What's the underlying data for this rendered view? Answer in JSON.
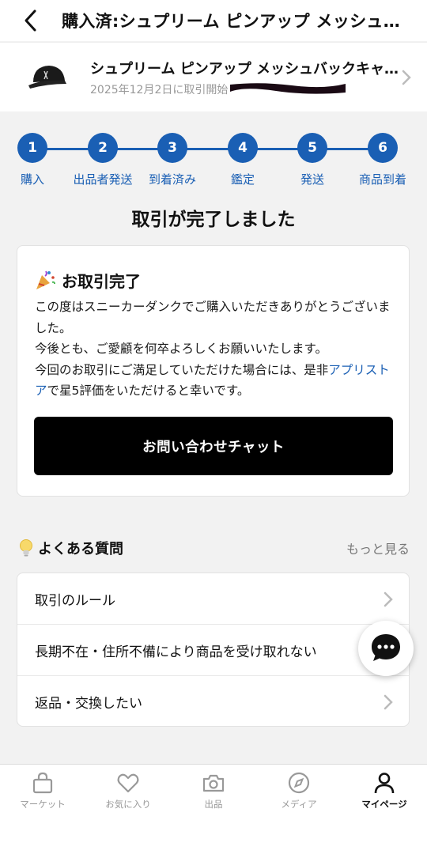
{
  "header": {
    "title": "購入済:シュプリーム ピンアップ メッシュバックキャップ"
  },
  "product": {
    "name": "シュプリーム ピンアップ メッシュバックキャップ",
    "subtitle": "2025年12月2日に取引開始"
  },
  "steps": [
    {
      "number": "1",
      "label": "購入"
    },
    {
      "number": "2",
      "label": "出品者発送"
    },
    {
      "number": "3",
      "label": "到着済み"
    },
    {
      "number": "4",
      "label": "鑑定"
    },
    {
      "number": "5",
      "label": "発送"
    },
    {
      "number": "6",
      "label": "商品到着"
    }
  ],
  "done_title": "取引が完了しました",
  "card": {
    "title": "お取引完了",
    "line1": "この度はスニーカーダンクでご購入いただきありがとうございました。",
    "line2": "今後とも、ご愛顧を何卒よろしくお願いいたします。",
    "line3_pre": "今回のお取引にご満足していただけた場合には、是非",
    "line3_link": "アプリストア",
    "line3_post": "で星5評価をいただけると幸いです。",
    "button": "お問い合わせチャット"
  },
  "faq": {
    "title": "よくある質問",
    "more": "もっと見る",
    "items": [
      "取引のルール",
      "長期不在・住所不備により商品を受け取れない",
      "返品・交換したい"
    ]
  },
  "tabs": [
    {
      "label": "マーケット",
      "icon": "bag-icon"
    },
    {
      "label": "お気に入り",
      "icon": "heart-icon"
    },
    {
      "label": "出品",
      "icon": "camera-icon"
    },
    {
      "label": "メディア",
      "icon": "compass-icon"
    },
    {
      "label": "マイページ",
      "icon": "person-icon"
    }
  ],
  "colors": {
    "accent": "#1a5fb4",
    "button": "#000000",
    "background": "#f2f2f2"
  }
}
